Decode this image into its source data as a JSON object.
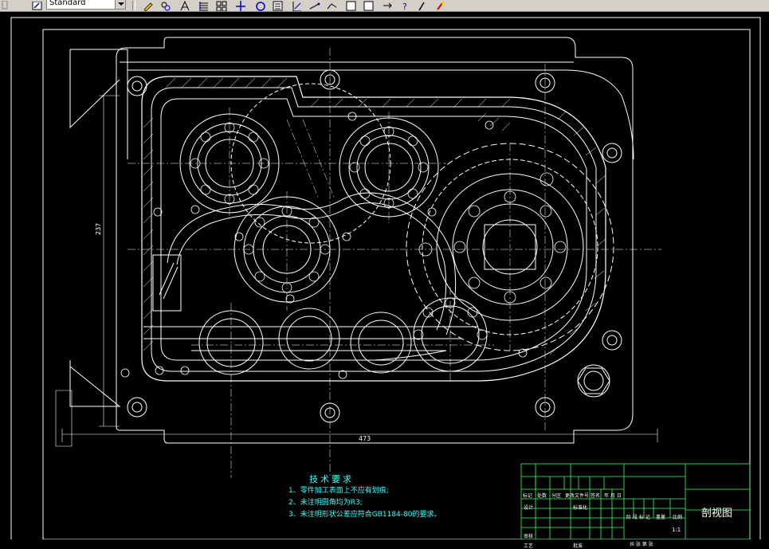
{
  "toolbar": {
    "style_value": "Standard",
    "icons": [
      "text-style-icon",
      "pencil-icon",
      "snap-icon",
      "dimension-icon",
      "hatch-icon",
      "grid-icon",
      "move-icon",
      "circle-icon",
      "block-icon",
      "ruler-icon",
      "line-icon",
      "polyline-icon",
      "rectangle-icon",
      "square-icon",
      "arrow-icon",
      "help-icon",
      "tool-icon",
      "paint-icon"
    ]
  },
  "drawing": {
    "dim_height": "237",
    "dim_width": "473"
  },
  "notes": {
    "title": "技术要求",
    "items": [
      "1、零件加工表面上不应有划痕;",
      "2、未注明圆角均为R3;",
      "3、未注明形状公差应符合GB1184-80的要求。"
    ]
  },
  "title_block": {
    "header_row": [
      "标记",
      "处数",
      "分区",
      "更改文件号",
      "签名",
      "年 月 日"
    ],
    "left_rows": [
      "设计",
      "",
      "审核",
      "工艺"
    ],
    "mid_rows": [
      "标准化",
      "",
      "",
      "批准"
    ],
    "mid2_rows": [
      "",
      "",
      "",
      "",
      "共",
      "张",
      "第",
      "张"
    ],
    "stage_labels": [
      "阶 段 标 记",
      "重量",
      "比例"
    ],
    "sheet_label": "共 张 第 张",
    "scale_value": "1:1",
    "drawing_title": "剖视图"
  }
}
